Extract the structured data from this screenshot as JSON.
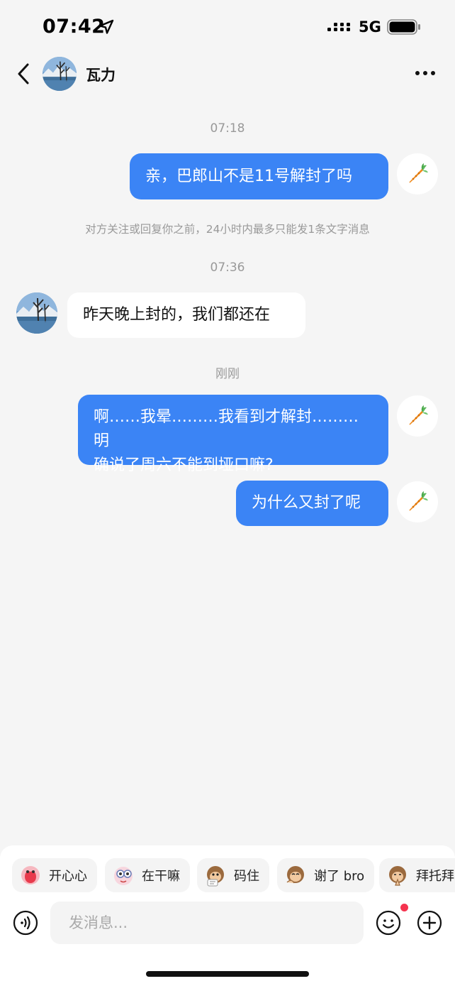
{
  "status_bar": {
    "time": "07:42",
    "network": "5G"
  },
  "header": {
    "name": "瓦力"
  },
  "messages": [
    {
      "kind": "timestamp",
      "text": "07:18"
    },
    {
      "kind": "outgoing",
      "text": "亲，巴郎山不是11号解封了吗"
    },
    {
      "kind": "notice",
      "text": "对方关注或回复你之前，24小时内最多只能发1条文字消息"
    },
    {
      "kind": "timestamp",
      "text": "07:36"
    },
    {
      "kind": "incoming",
      "text": "昨天晚上封的，我们都还在"
    },
    {
      "kind": "timestamp",
      "text": "刚刚"
    },
    {
      "kind": "outgoing",
      "lines": [
        "啊……我晕………我看到才解封………明",
        "确说了周六不能到垭口嘛?"
      ]
    },
    {
      "kind": "outgoing",
      "text": "为什么又封了呢"
    }
  ],
  "quick_replies": [
    {
      "label": "开心心",
      "icon": "happy-sticker-icon"
    },
    {
      "label": "在干嘛",
      "icon": "curious-sticker-icon"
    },
    {
      "label": "码住",
      "icon": "monkey-note-sticker-icon"
    },
    {
      "label": "谢了 bro",
      "icon": "monkey-thanks-sticker-icon"
    },
    {
      "label": "拜托拜",
      "icon": "monkey-please-sticker-icon"
    }
  ],
  "composer": {
    "placeholder": "发消息..."
  },
  "colors": {
    "outgoing_bubble": "#3b84f5",
    "background": "#f5f5f5",
    "notification_dot": "#f5334f"
  }
}
